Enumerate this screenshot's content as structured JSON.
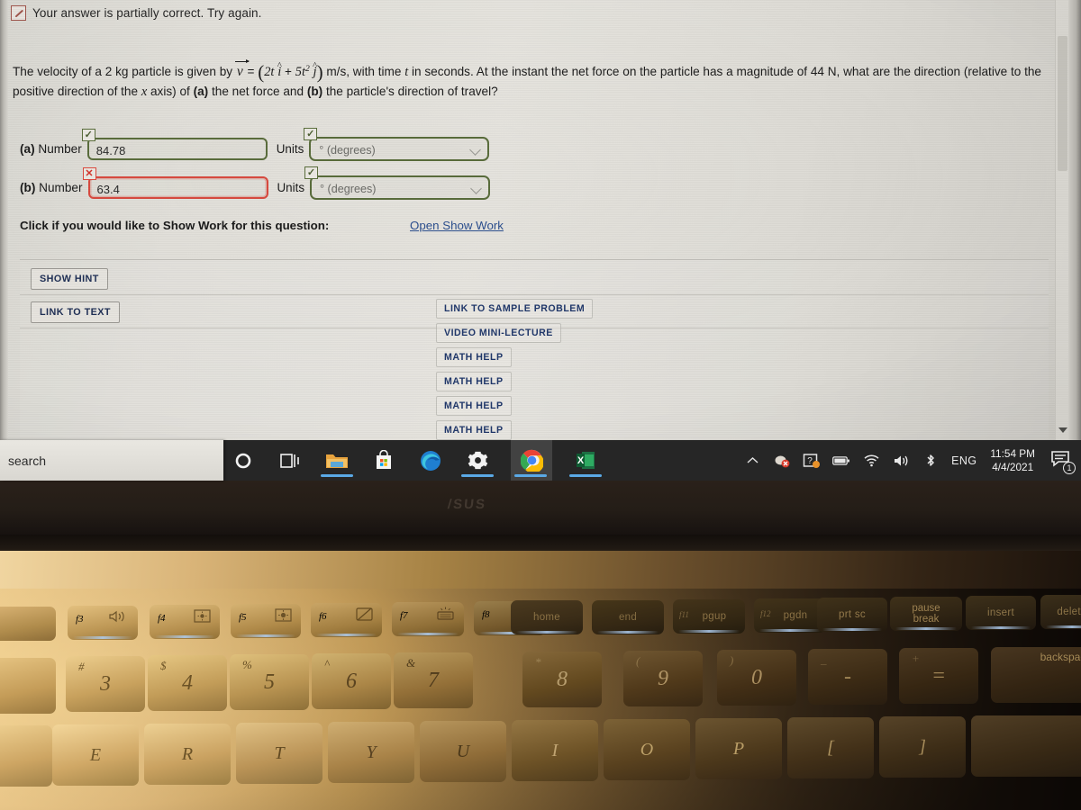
{
  "feedback": {
    "icon": "partial-credit-icon",
    "text": "Your answer is partially correct.  Try again."
  },
  "problem": {
    "line1_a": "The velocity of a 2 kg particle is given by ",
    "vector": "v",
    "eq": "=",
    "expr_open": "(",
    "expr_t": "2t",
    "expr_i": "i",
    "expr_plus": "+",
    "expr_5t": "5t",
    "expr_sup": "2",
    "expr_j": "j",
    "expr_close": ")",
    "line1_b": " m/s, with time ",
    "var_t": "t",
    "line1_c": " in seconds. At the instant the net force on the particle has a magnitude of 44 N, what are the direction (relative to the positive direction of the ",
    "var_x": "x",
    "line1_d": " axis) of ",
    "part_a": "(a)",
    "line1_e": " the net force and ",
    "part_b": "(b)",
    "line1_f": " the particle's direction of travel?"
  },
  "answers": [
    {
      "label_part": "(a)",
      "label_word": "Number",
      "value": "84.78",
      "status": "correct",
      "badge": "✓",
      "units_label": "Units",
      "units_value": "° (degrees)",
      "units_status": "correct",
      "units_badge": "✓"
    },
    {
      "label_part": "(b)",
      "label_word": "Number",
      "value": "63.4",
      "status": "incorrect",
      "badge": "✕",
      "units_label": "Units",
      "units_value": "° (degrees)",
      "units_status": "correct",
      "units_badge": "✓"
    }
  ],
  "show_work": {
    "prompt": "Click if you would like to Show Work for this question:",
    "link": "Open Show Work"
  },
  "left_buttons": [
    {
      "label": "SHOW HINT"
    },
    {
      "label": "LINK TO TEXT"
    }
  ],
  "right_buttons": [
    {
      "label": "LINK TO SAMPLE PROBLEM"
    },
    {
      "label": "VIDEO MINI-LECTURE"
    },
    {
      "label": "MATH HELP"
    },
    {
      "label": "MATH HELP"
    },
    {
      "label": "MATH HELP"
    },
    {
      "label": "MATH HELP"
    }
  ],
  "taskbar": {
    "search_text": "search",
    "icons": [
      {
        "name": "cortana-icon"
      },
      {
        "name": "task-view-icon"
      },
      {
        "name": "file-explorer-icon"
      },
      {
        "name": "microsoft-store-icon"
      },
      {
        "name": "microsoft-edge-icon"
      },
      {
        "name": "settings-gear-icon"
      },
      {
        "name": "google-chrome-icon"
      },
      {
        "name": "microsoft-excel-icon"
      }
    ],
    "tray": {
      "overflow": "chevron-up-icon",
      "security": "security-icon",
      "onedrive": "onedrive-icon",
      "battery": "battery-icon",
      "wifi": "wifi-icon",
      "volume": "volume-icon",
      "bluetooth": "bluetooth-icon",
      "language": "ENG",
      "time": "11:54 PM",
      "date": "4/4/2021",
      "notification_count": "1"
    }
  },
  "laptop": {
    "brand": "/SUS",
    "function_keys": [
      {
        "f": "f3",
        "glyph": "volume-up-icon"
      },
      {
        "f": "f4",
        "glyph": "brightness-down-icon"
      },
      {
        "f": "f5",
        "glyph": "brightness-up-icon"
      },
      {
        "f": "f6",
        "glyph": "touchpad-toggle-icon"
      },
      {
        "f": "f7",
        "glyph": "keyboard-backlight-icon"
      },
      {
        "f": "f8",
        "glyph": "display-switch-icon"
      }
    ],
    "nav_keys": [
      {
        "label": "home",
        "sub": ""
      },
      {
        "label": "end",
        "sub": ""
      },
      {
        "label": "pgup",
        "sub": "f11"
      },
      {
        "label": "pgdn",
        "sub": "f12"
      },
      {
        "label": "prt sc",
        "sub": ""
      },
      {
        "label": "pause",
        "sub": "break"
      },
      {
        "label": "insert",
        "sub": ""
      },
      {
        "label": "delete",
        "sub": ""
      }
    ],
    "number_keys": [
      {
        "num": "3",
        "sym": "#"
      },
      {
        "num": "4",
        "sym": "$"
      },
      {
        "num": "5",
        "sym": "%"
      },
      {
        "num": "6",
        "sym": "^"
      },
      {
        "num": "7",
        "sym": "&"
      },
      {
        "num": "8",
        "sym": "*"
      },
      {
        "num": "9",
        "sym": "("
      },
      {
        "num": "0",
        "sym": ")"
      },
      {
        "num": "-",
        "sym": "_"
      },
      {
        "num": "=",
        "sym": "+"
      }
    ],
    "backspace_label": "backspace",
    "letter_keys": [
      {
        "ltr": "E"
      },
      {
        "ltr": "R"
      },
      {
        "ltr": "T"
      },
      {
        "ltr": "Y"
      },
      {
        "ltr": "U"
      },
      {
        "ltr": "I"
      },
      {
        "ltr": "O"
      },
      {
        "ltr": "P"
      },
      {
        "ltr": "["
      },
      {
        "ltr": "]"
      }
    ]
  },
  "colors": {
    "correct_border": "#5a6d3c",
    "incorrect_border": "#d94a3f",
    "link": "#2c4f8f",
    "button_text": "#21386b",
    "taskbar": "#262626",
    "taskbar_accent": "#5aa9e6"
  }
}
